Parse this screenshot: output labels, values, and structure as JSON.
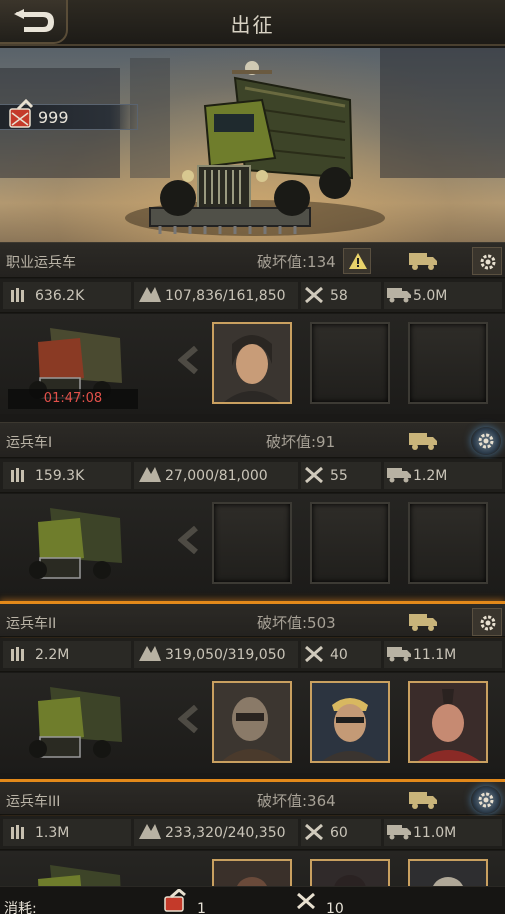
{
  "header": {
    "title": "出征"
  },
  "currency": {
    "value": "999"
  },
  "sections": [
    {
      "name": "职业运兵车",
      "damage": "破坏值:134",
      "stats": {
        "troops": "636.2K",
        "capacity": "107,836/161,850",
        "repair": "58",
        "load": "5.0M"
      },
      "timer": "01:47:08",
      "heroes": [
        "hero-longhair",
        "empty",
        "empty"
      ]
    },
    {
      "name": "运兵车I",
      "damage": "破坏值:91",
      "stats": {
        "troops": "159.3K",
        "capacity": "27,000/81,000",
        "repair": "55",
        "load": "1.2M"
      },
      "heroes": [
        "empty",
        "empty",
        "empty"
      ]
    },
    {
      "name": "运兵车II",
      "damage": "破坏值:503",
      "stats": {
        "troops": "2.2M",
        "capacity": "319,050/319,050",
        "repair": "40",
        "load": "11.1M"
      },
      "heroes": [
        "hero-masked",
        "hero-blond",
        "hero-mohawk"
      ]
    },
    {
      "name": "运兵车III",
      "damage": "破坏值:364",
      "stats": {
        "troops": "1.3M",
        "capacity": "233,320/240,350",
        "repair": "60",
        "load": "11.0M"
      },
      "heroes": [
        "hero-1",
        "hero-2",
        "hero-3"
      ]
    }
  ],
  "footer": {
    "label": "消耗:",
    "cost_fuel": "1",
    "cost_repair": "10"
  }
}
